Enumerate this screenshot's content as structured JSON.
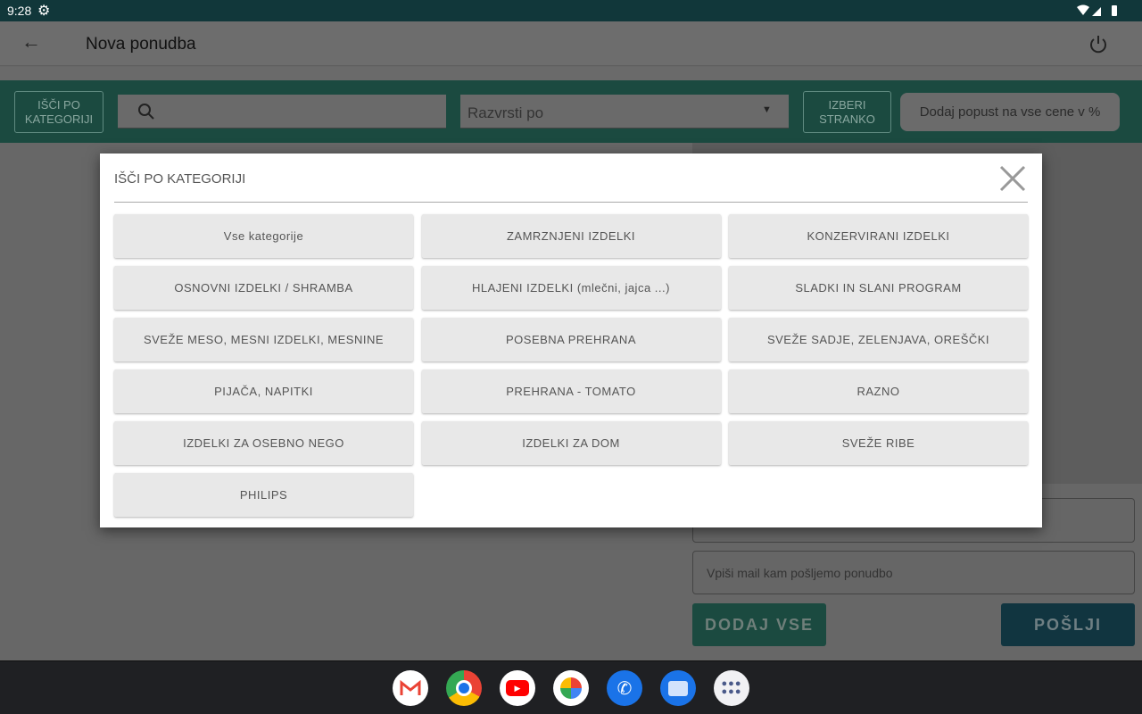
{
  "status_bar": {
    "time": "9:28"
  },
  "app_bar": {
    "title": "Nova ponudba"
  },
  "toolbar": {
    "category_button": "IŠČI PO KATEGORIJI",
    "search_placeholder": "",
    "sort_placeholder": "Razvrsti po",
    "customer_button": "IZBERI STRANKO",
    "discount_placeholder": "Dodaj popust na vse cene v %"
  },
  "right_panel": {
    "email_placeholder": "Vpiši mail kam pošljemo ponudbo",
    "add_all_button": "DODAJ VSE",
    "send_button": "POŠLJI"
  },
  "dialog": {
    "title": "IŠČI PO KATEGORIJI",
    "categories": [
      "Vse kategorije",
      "ZAMRZNJENI IZDELKI",
      "KONZERVIRANI IZDELKI",
      "OSNOVNI IZDELKI / SHRAMBA",
      "HLAJENI IZDELKI (mlečni, jajca ...)",
      "SLADKI IN SLANI PROGRAM",
      "SVEŽE MESO, MESNI IZDELKI, MESNINE",
      "POSEBNA PREHRANA",
      "SVEŽE SADJE, ZELENJAVA, OREŠČKI",
      "PIJAČA, NAPITKI",
      "PREHRANA - TOMATO",
      "RAZNO",
      "IZDELKI ZA OSEBNO NEGO",
      "IZDELKI ZA DOM",
      "SVEŽE RIBE",
      "PHILIPS"
    ]
  },
  "dock": [
    "gmail-icon",
    "chrome-icon",
    "youtube-icon",
    "photos-icon",
    "phone-icon",
    "messages-icon",
    "app-drawer-icon"
  ]
}
